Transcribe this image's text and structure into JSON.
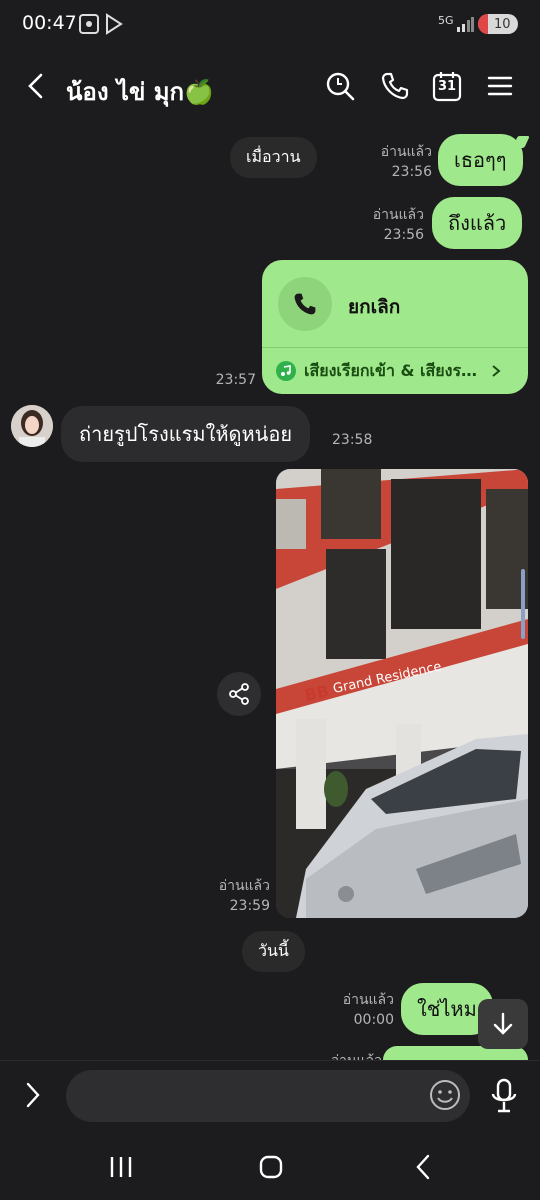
{
  "status_bar": {
    "time": "00:47",
    "network": "5G",
    "battery": "10"
  },
  "header": {
    "title": "น้อง ไข่ มุก🍏",
    "icons": [
      "back-icon",
      "search-icon",
      "phone-icon",
      "calendar-icon",
      "menu-icon"
    ],
    "calendar_day": "31"
  },
  "messages": {
    "date_yesterday": "เมื่อวาน",
    "msg1": {
      "text": "เธอๆๆ",
      "read": "อ่านแล้ว",
      "time": "23:56"
    },
    "msg2": {
      "text": "ถึงแล้ว",
      "read": "อ่านแล้ว",
      "time": "23:56"
    },
    "call": {
      "label": "ยกเลิก",
      "ringtone": "เสียงเรียกเข้า & เสียงรอสาย",
      "time": "23:57"
    },
    "msg_in": {
      "text": "ถ่ายรูปโรงแรมให้ดูหน่อย",
      "time": "23:58"
    },
    "photo": {
      "read": "อ่านแล้ว",
      "time": "23:59",
      "sign_text": "Grand Residence",
      "sign_logo": "BB"
    },
    "date_today": "วันนี้",
    "msg3": {
      "text": "ใช่ไหม",
      "read": "อ่านแล้ว",
      "time": "00:00"
    },
    "msg4_partial_read": "อ่านแล้ว"
  },
  "input": {
    "placeholder": ""
  },
  "colors": {
    "outgoing_bubble": "#a0e88c",
    "incoming_bubble": "#2c2c2e",
    "background": "#1c1c1e"
  }
}
